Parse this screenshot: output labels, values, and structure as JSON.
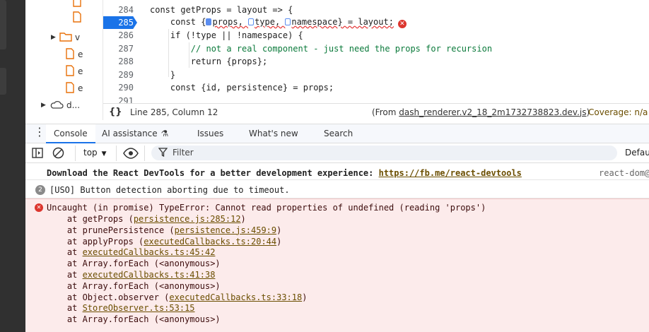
{
  "filetree": {
    "items": [
      "e",
      "e",
      "e"
    ],
    "folder_label": "v",
    "cloud_label": "d..."
  },
  "editor": {
    "lines": [
      {
        "num": "284",
        "text": "const getProps = layout => {"
      },
      {
        "num": "285",
        "pre": "    const {",
        "a": "props, ",
        "b": "type, ",
        "c": "namespace} = layout;",
        "active": true
      },
      {
        "num": "286",
        "text": "    if (!type || !namespace) {"
      },
      {
        "num": "287",
        "text": "        // not a real component - just need the props for recursion",
        "comment": true
      },
      {
        "num": "288",
        "text": "        return {props};"
      },
      {
        "num": "289",
        "text": "    }"
      },
      {
        "num": "290",
        "text": "    const {id, persistence} = props;"
      },
      {
        "num": "291",
        "text": ""
      }
    ],
    "error_icon": "error-circle-icon"
  },
  "statusbar": {
    "braces": "{}",
    "position": "Line 285, Column 12",
    "from_prefix": "(From ",
    "from_file": "dash_renderer.v2_18_2m1732738823.dev.js",
    "from_suffix": ")",
    "coverage": "Coverage: n/a"
  },
  "tabs": {
    "items": [
      "Console",
      "AI assistance",
      "Issues",
      "What's new",
      "Search"
    ],
    "active_index": 0
  },
  "toolbar": {
    "context": "top",
    "filter_placeholder": "Filter",
    "levels": "Defau"
  },
  "console": {
    "devtools_msg": "Download the React DevTools for a better development experience: ",
    "devtools_link": "https://fb.me/react-devtools",
    "devtools_source": "react-dom@",
    "uso_count": "2",
    "uso_msg": "[USO] Button detection aborting due to timeout.",
    "error_title": "Uncaught (in promise) TypeError: Cannot read properties of undefined (reading 'props')",
    "stack": [
      {
        "prefix": "    at getProps (",
        "link": "persistence.js:285:12",
        "suffix": ")"
      },
      {
        "prefix": "    at prunePersistence (",
        "link": "persistence.js:459:9",
        "suffix": ")"
      },
      {
        "prefix": "    at applyProps (",
        "link": "executedCallbacks.ts:20:44",
        "suffix": ")"
      },
      {
        "prefix": "    at ",
        "link": "executedCallbacks.ts:45:42",
        "suffix": ""
      },
      {
        "prefix": "    at Array.forEach (<anonymous>)",
        "link": "",
        "suffix": ""
      },
      {
        "prefix": "    at ",
        "link": "executedCallbacks.ts:41:38",
        "suffix": ""
      },
      {
        "prefix": "    at Array.forEach (<anonymous>)",
        "link": "",
        "suffix": ""
      },
      {
        "prefix": "    at Object.observer (",
        "link": "executedCallbacks.ts:33:18",
        "suffix": ")"
      },
      {
        "prefix": "    at ",
        "link": "StoreObserver.ts:53:15",
        "suffix": ""
      },
      {
        "prefix": "    at Array.forEach (<anonymous>)",
        "link": "",
        "suffix": ""
      }
    ]
  },
  "colors": {
    "accent": "#1a73e8",
    "error_bg": "#fcebeb",
    "error_text": "#dc362e",
    "link": "#6b4e00"
  }
}
